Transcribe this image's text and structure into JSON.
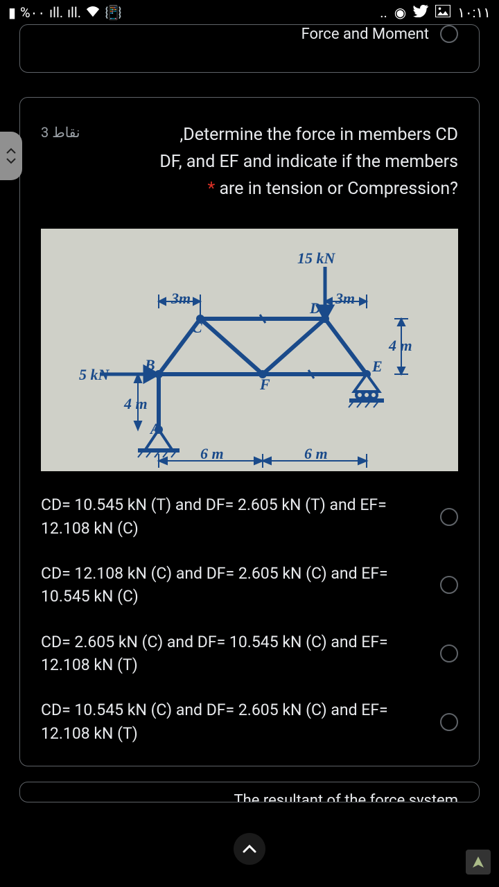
{
  "status": {
    "battery": "%٠٠",
    "time": "١٠:١١",
    "dots": ".."
  },
  "prev_card": {
    "title": "Force and Moment"
  },
  "question": {
    "points": "3 نقاط",
    "text_line1": "Determine the force in members CD,",
    "text_line2": "DF, and EF and indicate if the members",
    "text_line3": "are in tension or Compression?"
  },
  "diagram": {
    "top_load": "15 kN",
    "left_load": "5 kN",
    "dim_3m_left": "3m",
    "dim_3m_right": "3m",
    "dim_4m_left": "4 m",
    "dim_4m_right": "4 m",
    "dim_6m_left": "6 m",
    "dim_6m_right": "6 m",
    "label_A": "A",
    "label_B": "B",
    "label_C": "C",
    "label_D": "D",
    "label_E": "E",
    "label_F": "F"
  },
  "options": [
    "CD= 10.545 kN (T) and DF= 2.605 kN (T) and EF= 12.108 kN (C)",
    "CD= 12.108 kN (C) and DF= 2.605 kN (C) and EF= 10.545 kN (C)",
    "CD= 2.605 kN (C) and DF= 10.545 kN (C) and EF= 12.108 kN (T)",
    "CD= 10.545 kN (C) and DF= 2.605 kN (C) and EF= 12.108 kN (T)"
  ],
  "next_card": {
    "text": "The resultant of the force system"
  }
}
